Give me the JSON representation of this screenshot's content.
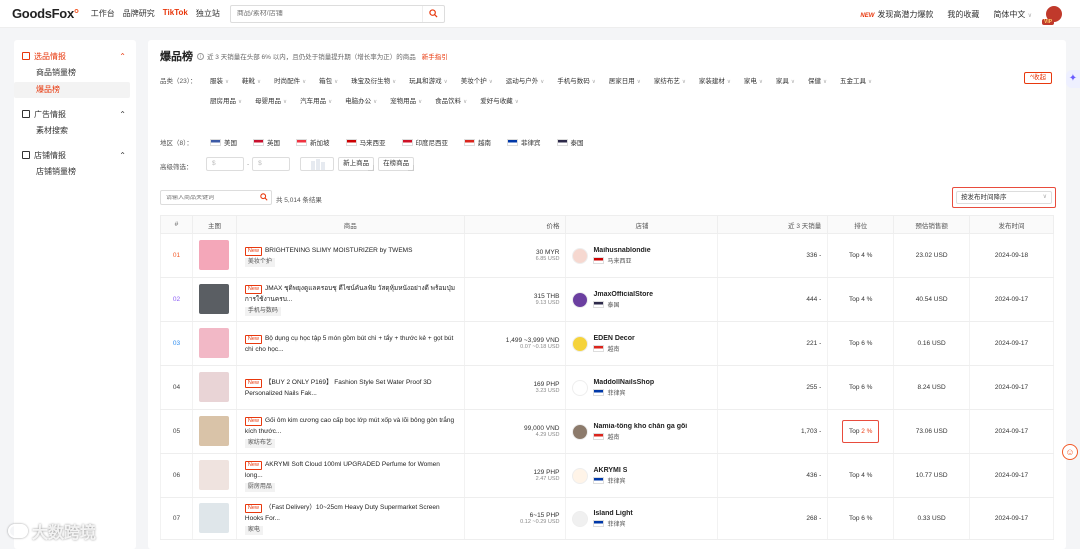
{
  "header": {
    "logo": "GoodsFox",
    "nav": [
      "工作台",
      "品牌研究",
      "TikTok",
      "独立站"
    ],
    "search_placeholder": "商品/素材/店铺",
    "new_badge": "NEW",
    "promo_link": "发现高潜力爆款",
    "favorites": "我的收藏",
    "language": "简体中文",
    "vip_label": "VIP"
  },
  "sidebar": {
    "groups": [
      {
        "label": "选品情报",
        "items": [
          "商品销量榜",
          "爆品榜"
        ]
      },
      {
        "label": "广告情报",
        "items": [
          "素材搜索"
        ]
      },
      {
        "label": "店铺情报",
        "items": [
          "店铺销量榜"
        ]
      }
    ]
  },
  "page": {
    "title": "爆品榜",
    "description": "近 3 天销量在头部 6% 以内，且仍处于销量提升期（增长率为正）的商品",
    "guide_link": "新手指引"
  },
  "filters": {
    "category_label": "品类（23）：",
    "categories_row1": [
      "服装",
      "鞋靴",
      "时尚配件",
      "箱包",
      "珠宝及衍生物",
      "玩具和游戏",
      "美妆个护",
      "运动与户外",
      "手机与数码",
      "居家日用",
      "家纺布艺",
      "家装建材",
      "家电",
      "家具",
      "保健",
      "五金工具"
    ],
    "categories_row2": [
      "厨房用品",
      "母婴用品",
      "汽车用品",
      "电脑办公",
      "宠物用品",
      "食品饮料",
      "爱好与收藏"
    ],
    "collapse_label": "^收起",
    "region_label": "地区（8）：",
    "regions": [
      {
        "name": "美国",
        "color": "#3c5aa6"
      },
      {
        "name": "英国",
        "color": "#c8102e"
      },
      {
        "name": "新加坡",
        "color": "#ef3340"
      },
      {
        "name": "马来西亚",
        "color": "#cc0001"
      },
      {
        "name": "印度尼西亚",
        "color": "#ce1126"
      },
      {
        "name": "越南",
        "color": "#da251d"
      },
      {
        "name": "菲律宾",
        "color": "#0038a8"
      },
      {
        "name": "泰国",
        "color": "#2d2a4a"
      }
    ],
    "advanced_label": "高级筛选：",
    "currency_symbol": "$",
    "range_dash": "-",
    "new_product": "新上商品",
    "on_list": "在榜商品"
  },
  "toolbar": {
    "search_placeholder": "请输入商品关键词",
    "total_text": "共 5,014 条结果",
    "sort_value": "按发布时间降序"
  },
  "table": {
    "columns": [
      "#",
      "主图",
      "商品",
      "价格",
      "店铺",
      "近 3 天销量",
      "排位",
      "预估销售额",
      "发布时间"
    ],
    "rows": [
      {
        "rank": "01",
        "rank_class": "idx-o",
        "thumb": "#f4a7b9",
        "new": "New",
        "title": "BRIGHTENING SLIMY MOISTURIZER by TWEMS",
        "category": "美妆个护",
        "price": "30 MYR",
        "price_usd": "6.85 USD",
        "shop": "Maihusnablondie",
        "shop_logo": "#f6d8d0",
        "region": "马来西亚",
        "flag": "#cc0001",
        "sales": "336 -",
        "top": "Top 4 %",
        "est": "23.02 USD",
        "date": "2024-09-18"
      },
      {
        "rank": "02",
        "rank_class": "idx-p",
        "thumb": "#5a5e63",
        "new": "New",
        "title": "JMAX ชุดิพยุงดูแลครอบชุ ดีไซน์คันลฟัย วัสดุหุ้มหนังอย่างดี พร้อมปุ่มการใช้งานครบ...",
        "category": "手机与数码",
        "price": "315 THB",
        "price_usd": "9.13 USD",
        "shop": "JmaxOfficialStore",
        "shop_logo": "#6b3fa0",
        "region": "泰国",
        "flag": "#2d2a4a",
        "sales": "444 -",
        "top": "Top 4 %",
        "est": "40.54 USD",
        "date": "2024-09-17"
      },
      {
        "rank": "03",
        "rank_class": "idx-b",
        "thumb": "#f2b8c6",
        "new": "New",
        "title": "Bộ dụng cụ học tập 5 món gồm bút chì + tẩy + thước kẻ + gọt bút chì cho học...",
        "category": "",
        "price": "1,499 ~3,999 VND",
        "price_usd": "0.07 ~0.18 USD",
        "shop": "EDEN Decor",
        "shop_logo": "#f5d33b",
        "region": "越南",
        "flag": "#da251d",
        "sales": "221 -",
        "top": "Top 6 %",
        "est": "0.16 USD",
        "date": "2024-09-17"
      },
      {
        "rank": "04",
        "rank_class": "idx-n",
        "thumb": "#e9d4d6",
        "new": "New",
        "title": "【BUY 2 ONLY P169】 Fashion Style Set Water Proof 3D Personalized Nails Fak...",
        "category": "",
        "price": "169 PHP",
        "price_usd": "3.23 USD",
        "shop": "MaddollNailsShop",
        "shop_logo": "#ffffff",
        "region": "菲律宾",
        "flag": "#0038a8",
        "sales": "255 -",
        "top": "Top 6 %",
        "est": "8.24 USD",
        "date": "2024-09-17"
      },
      {
        "rank": "05",
        "rank_class": "idx-n",
        "thumb": "#d9c3a8",
        "new": "New",
        "title": "Gối ôm kim cương cao cấp bọc lớp mút xốp và lõi bông gòn trắng kích thước...",
        "category": "家纺布艺",
        "price": "99,000 VND",
        "price_usd": "4.29 USD",
        "shop": "Namia-tổng kho chăn ga gối",
        "shop_logo": "#8c7a6b",
        "region": "越南",
        "flag": "#da251d",
        "sales": "1,703 -",
        "top_prefix": "Top ",
        "top_red": "2 %",
        "highlight": true,
        "est": "73.06 USD",
        "date": "2024-09-17"
      },
      {
        "rank": "06",
        "rank_class": "idx-n",
        "thumb": "#efe3df",
        "new": "New",
        "title": "AKRYMI Soft Cloud 100ml UPGRADED Perfume for Women long...",
        "category": "厨房用品",
        "price": "129 PHP",
        "price_usd": "2.47 USD",
        "shop": "AKRYMI S",
        "shop_logo": "#fff4e8",
        "region": "菲律宾",
        "flag": "#0038a8",
        "sales": "436 -",
        "top": "Top 4 %",
        "est": "10.77 USD",
        "date": "2024-09-17"
      },
      {
        "rank": "07",
        "rank_class": "idx-n",
        "thumb": "#dfe6ea",
        "new": "New",
        "title": "（Fast Delivery）10~25cm Heavy Duty Supermarket Screen Hooks For...",
        "category": "家电",
        "price": "6~15 PHP",
        "price_usd": "0.12 ~0.29 USD",
        "shop": "Island Light",
        "shop_logo": "#f0f0f0",
        "region": "菲律宾",
        "flag": "#0038a8",
        "sales": "268 -",
        "top": "Top 6 %",
        "est": "0.33 USD",
        "date": "2024-09-17"
      }
    ]
  },
  "watermark": "大数跨境",
  "colors": {
    "accent": "#e8380d",
    "highlight_border": "#e84c3d"
  }
}
